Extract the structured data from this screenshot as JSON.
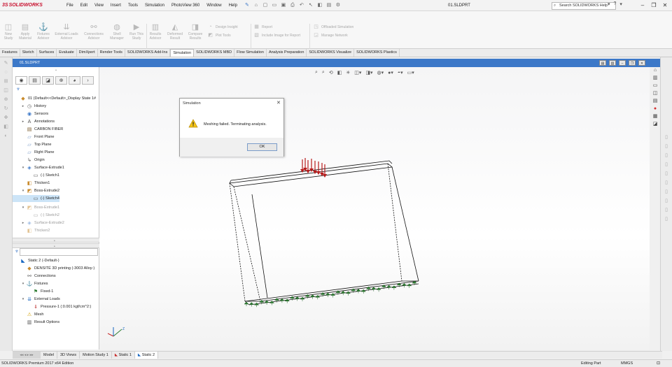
{
  "app": {
    "logo_text": "SOLIDWORKS",
    "doc_title": "01.SLDPRT",
    "search_placeholder": "Search SOLIDWORKS Help"
  },
  "menus": [
    "File",
    "Edit",
    "View",
    "Insert",
    "Tools",
    "Simulation",
    "PhotoView 360",
    "Window",
    "Help"
  ],
  "ribbon": {
    "large": [
      {
        "label_1": "New",
        "label_2": "Study",
        "icon": "new-study-icon"
      },
      {
        "label_1": "Apply",
        "label_2": "Material",
        "icon": "apply-material-icon"
      },
      {
        "label_1": "Fixtures",
        "label_2": "Advisor",
        "icon": "fixtures-icon"
      },
      {
        "label_1": "External Loads",
        "label_2": "Advisor",
        "icon": "external-loads-icon"
      },
      {
        "label_1": "Connections",
        "label_2": "Advisor",
        "icon": "connections-icon"
      },
      {
        "label_1": "Shell",
        "label_2": "Manager",
        "icon": "shell-manager-icon"
      },
      {
        "label_1": "Run This",
        "label_2": "Study",
        "icon": "run-study-icon"
      },
      {
        "label_1": "Results",
        "label_2": "Advisor",
        "icon": "results-advisor-icon"
      },
      {
        "label_1": "Deformed",
        "label_2": "Result",
        "icon": "deformed-result-icon"
      },
      {
        "label_1": "Compare",
        "label_2": "Results",
        "icon": "compare-results-icon"
      }
    ],
    "small": [
      {
        "label": "Design Insight",
        "icon": "design-insight-icon"
      },
      {
        "label": "Plot Tools",
        "icon": "plot-tools-icon"
      },
      {
        "label": "Report",
        "icon": "report-icon"
      },
      {
        "label": "Include Image for Report",
        "icon": "include-image-icon"
      },
      {
        "label": "Offloaded Simulation",
        "icon": "offloaded-simulation-icon"
      },
      {
        "label": "Manage Network",
        "icon": "manage-network-icon"
      }
    ]
  },
  "tabs": [
    "Features",
    "Sketch",
    "Surfaces",
    "Evaluate",
    "DimXpert",
    "Render Tools",
    "SOLIDWORKS Add-Ins",
    "Simulation",
    "SOLIDWORKS MBD",
    "Flow Simulation",
    "Analysis Preparation",
    "SOLIDWORKS Visualize",
    "SOLIDWORKS Plastics"
  ],
  "active_tab": "Simulation",
  "feature_tree": [
    {
      "label": "01  (Default<<Default>_Display State 1#",
      "icon": "part-icon",
      "toggle": "",
      "indent": 0
    },
    {
      "label": "History",
      "icon": "history-icon",
      "toggle": "▸",
      "indent": 1
    },
    {
      "label": "Sensors",
      "icon": "sensors-icon",
      "toggle": "",
      "indent": 1
    },
    {
      "label": "Annotations",
      "icon": "annotations-icon",
      "toggle": "▸",
      "indent": 1
    },
    {
      "label": "CARBON FIBER",
      "icon": "material-icon",
      "toggle": "",
      "indent": 1
    },
    {
      "label": "Front Plane",
      "icon": "plane-icon",
      "toggle": "",
      "indent": 1
    },
    {
      "label": "Top Plane",
      "icon": "plane-icon",
      "toggle": "",
      "indent": 1
    },
    {
      "label": "Right Plane",
      "icon": "plane-icon",
      "toggle": "",
      "indent": 1
    },
    {
      "label": "Origin",
      "icon": "origin-icon",
      "toggle": "",
      "indent": 1
    },
    {
      "label": "Surface-Extrude1",
      "icon": "surface-extrude-icon",
      "toggle": "▾",
      "indent": 1
    },
    {
      "label": "(-) Sketch1",
      "icon": "sketch-icon",
      "toggle": "",
      "indent": 2
    },
    {
      "label": "Thicken1",
      "icon": "thicken-icon",
      "toggle": "",
      "indent": 1
    },
    {
      "label": "Boss-Extrude2",
      "icon": "boss-extrude-icon",
      "toggle": "▾",
      "indent": 1
    },
    {
      "label": "(-) Sketch4",
      "icon": "sketch-icon",
      "toggle": "",
      "indent": 2,
      "selected": true
    }
  ],
  "feature_tree_grey": [
    {
      "label": "Boss-Extrude1",
      "icon": "boss-extrude-icon",
      "toggle": "▾",
      "indent": 1
    },
    {
      "label": "(-) Sketch2",
      "icon": "sketch-icon",
      "toggle": "",
      "indent": 2
    },
    {
      "label": "Surface-Extrude2",
      "icon": "surface-extrude-icon",
      "toggle": "▸",
      "indent": 1
    },
    {
      "label": "Thicken2",
      "icon": "thicken-icon",
      "toggle": "",
      "indent": 1
    }
  ],
  "sim_tree": [
    {
      "label": "Static 2 (-Default-)",
      "icon": "static-study-icon",
      "toggle": "",
      "indent": 0
    },
    {
      "label": "DENSITÉ 3D printing (-3003 Alloy-)",
      "icon": "part-body-icon",
      "toggle": "",
      "indent": 1
    },
    {
      "label": "Connections",
      "icon": "connections-icon",
      "toggle": "",
      "indent": 1
    },
    {
      "label": "Fixtures",
      "icon": "fixtures-icon",
      "toggle": "▾",
      "indent": 1
    },
    {
      "label": "Fixed-1",
      "icon": "fixed-icon",
      "toggle": "",
      "indent": 2
    },
    {
      "label": "External Loads",
      "icon": "external-loads-icon",
      "toggle": "▾",
      "indent": 1
    },
    {
      "label": "Pressure-1 (:0.001 kgf/cm^2:)",
      "icon": "pressure-icon",
      "toggle": "",
      "indent": 2
    },
    {
      "label": "Mesh",
      "icon": "mesh-warning-icon",
      "toggle": "",
      "indent": 1
    },
    {
      "label": "Result Options",
      "icon": "result-options-icon",
      "toggle": "",
      "indent": 1
    }
  ],
  "dialog": {
    "title": "Simulation",
    "message": "Meshing failed. Terminating analysis.",
    "ok": "OK"
  },
  "bottom_tabs": [
    "Model",
    "3D Views",
    "Motion Study 1",
    "Static 1",
    "Static 2"
  ],
  "active_bottom_tab": "Static 2",
  "status": {
    "edition": "SOLIDWORKS Premium 2017 x64 Edition",
    "mode": "Editing Part",
    "units": "MMGS"
  },
  "colors": {
    "header_blue": "#3c78c8",
    "fixture_green": "#2e7d32",
    "load_red": "#b71c1c",
    "warning_yellow": "#f5c518"
  }
}
